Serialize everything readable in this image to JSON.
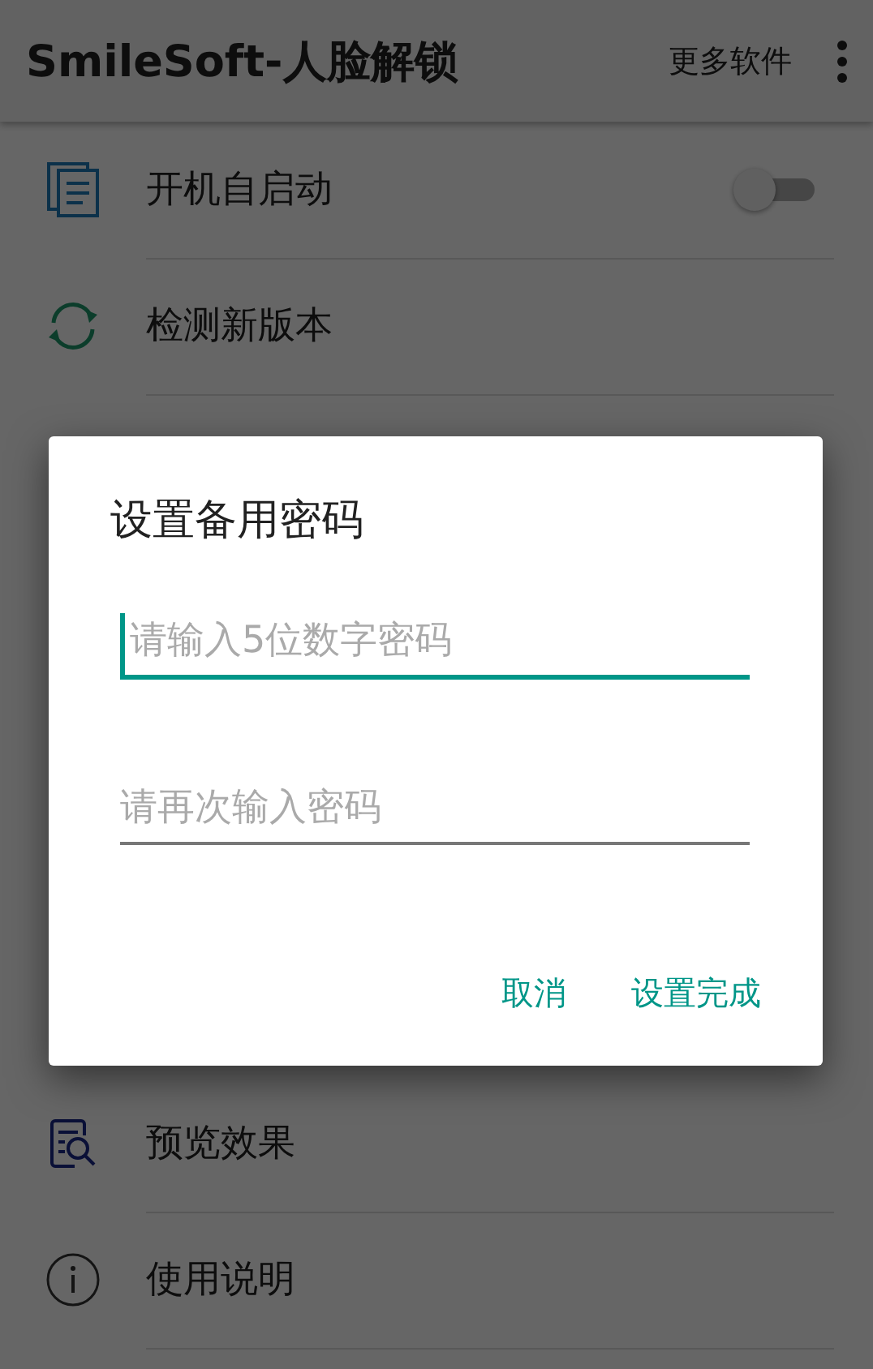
{
  "app_bar": {
    "title": "SmileSoft-人脸解锁",
    "action": "更多软件"
  },
  "settings_items": [
    {
      "kind": "toggle",
      "label": "开机自启动",
      "checked": false
    },
    {
      "kind": "plain",
      "label": "检测新版本"
    }
  ],
  "settings_items_bottom": [
    {
      "kind": "plain",
      "label": "预览效果"
    },
    {
      "kind": "plain",
      "label": "使用说明"
    }
  ],
  "dialog": {
    "title": "设置备用密码",
    "fields": [
      {
        "placeholder": "请输入5位数字密码",
        "focused": true
      },
      {
        "placeholder": "请再次输入密码",
        "focused": false
      }
    ],
    "buttons": [
      "取消",
      "设置完成"
    ]
  }
}
